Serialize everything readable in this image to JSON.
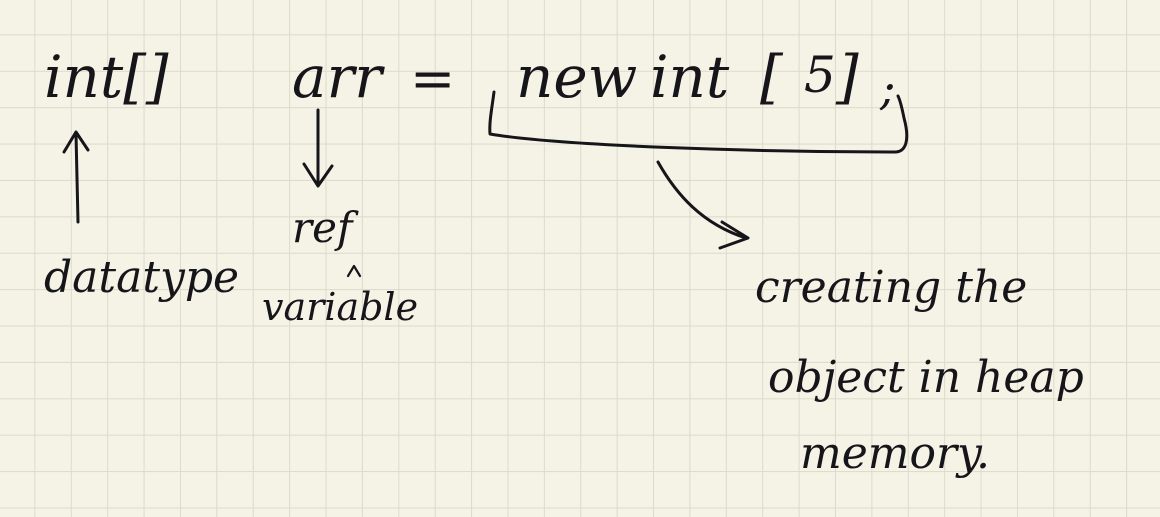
{
  "code": {
    "type": "int[]",
    "name": "arr",
    "equals": "=",
    "keyword_new": "new",
    "alloc_type": "int",
    "size_open": "[",
    "size": "5",
    "size_close": "]",
    "semicolon": ";"
  },
  "annotations": {
    "datatype": "datatype",
    "ref_line1": "ref",
    "ref_line2": "variable",
    "heap_line1": "creating the",
    "heap_line2": "object in heap",
    "heap_line3": "memory."
  },
  "colors": {
    "paper": "#f5f3e6",
    "grid": "#dcdacb",
    "ink": "#15151a"
  }
}
